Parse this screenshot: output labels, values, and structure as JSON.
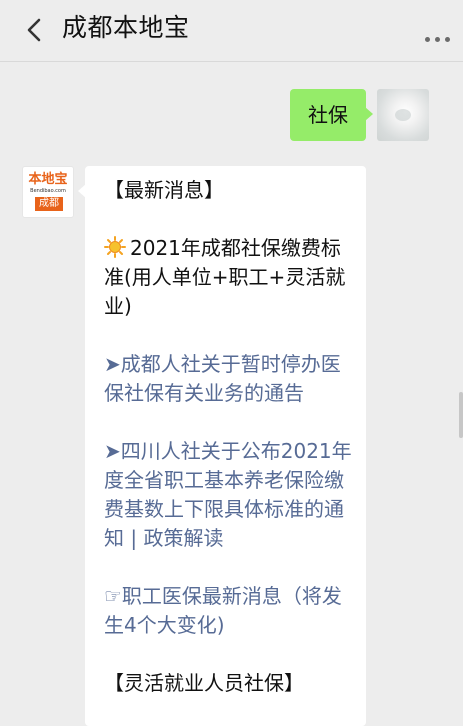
{
  "header": {
    "title": "成都本地宝",
    "back_icon": "chevron-left-icon",
    "more_icon": "more-dots-icon"
  },
  "user_message": {
    "text": "社保",
    "bubble_color": "#95ec69"
  },
  "bot_avatar": {
    "brand_text": "本地宝",
    "site_text": "Bendibao.com",
    "city_tag": "成都",
    "accent_color": "#e8631a"
  },
  "bot_message": {
    "heading1": "【最新消息】",
    "item1_icon": "sun-icon",
    "item1_text": "2021年成都社保缴费标准(用人单位+职工+灵活就业)",
    "item2_text": "➤成都人社关于暂时停办医保社保有关业务的通告",
    "item3_text": "➤四川人社关于公布2021年度全省职工基本养老保险缴费基数上下限具体标准的通知 | 政策解读",
    "item4_text": "☞职工医保最新消息（将发生4个大变化)",
    "heading2": "【灵活就业人员社保】",
    "link_color": "#576b95"
  }
}
